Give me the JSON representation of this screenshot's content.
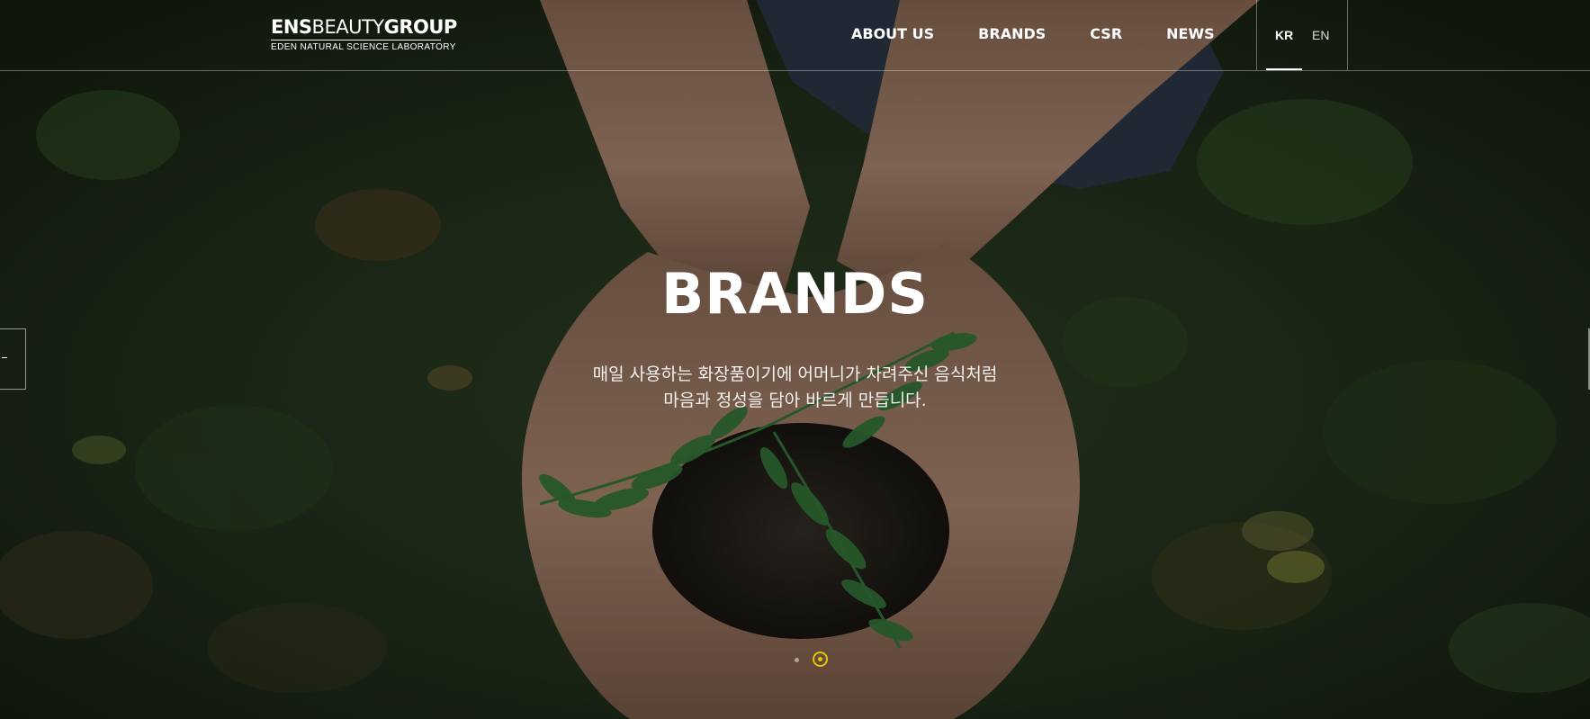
{
  "header": {
    "logo": {
      "main_bold_1": "ENS",
      "main_light": "BEAUTY",
      "main_bold_2": "GROUP",
      "sub": "EDEN NATURAL SCIENCE LABORATORY"
    },
    "nav": [
      "ABOUT US",
      "BRANDS",
      "CSR",
      "NEWS"
    ],
    "languages": {
      "active": "KR",
      "other": "EN"
    }
  },
  "hero": {
    "title": "BRANDS",
    "subtitle_line1": "매일 사용하는 화장품이기에 어머니가 차려주신 음식처럼",
    "subtitle_line2": "마음과 정성을 담아 바르게 만듭니다.",
    "slide_dots": {
      "count": 2,
      "active_index": 1
    }
  },
  "colors": {
    "accent_dot": "#e6c200",
    "background_dark": "#1c2a17"
  },
  "icons": {
    "prev": "arrow-left-icon"
  }
}
